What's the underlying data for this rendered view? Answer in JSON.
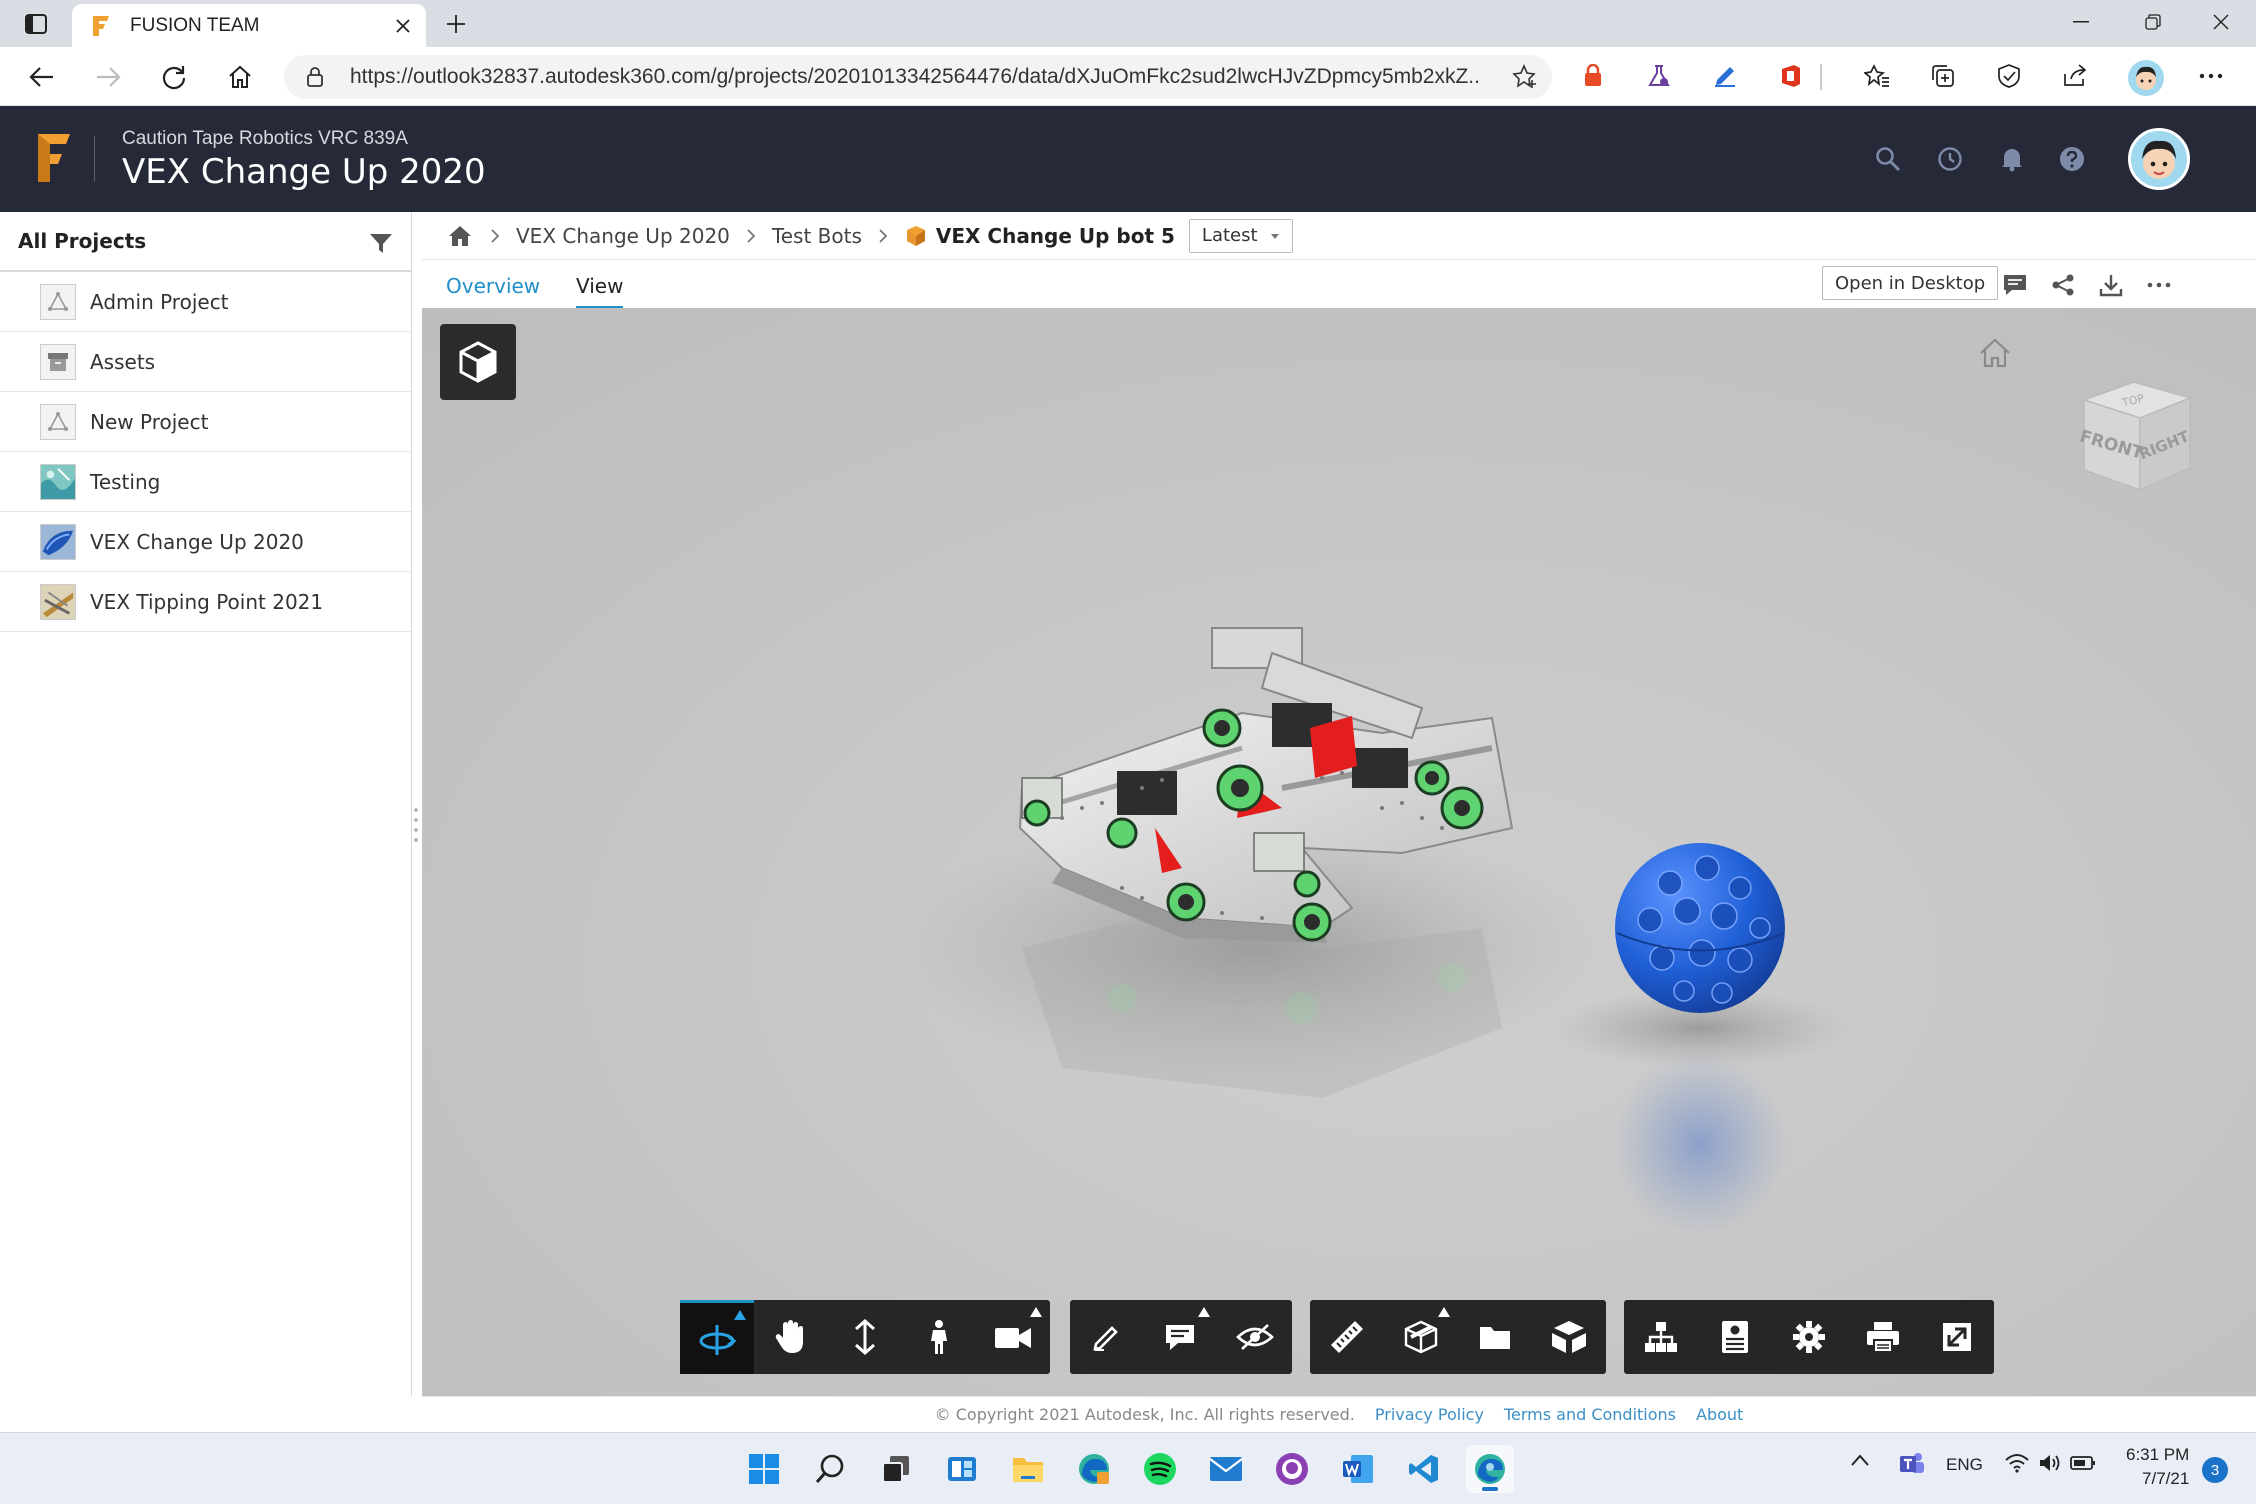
{
  "browser": {
    "tab_title": "FUSION TEAM",
    "url": "https://outlook32837.autodesk360.com/g/projects/20201013342564476/data/dXJuOmFkc2sud2lwcHJvZDpmcy5mb2xkZ..."
  },
  "header": {
    "hub_name": "Caution Tape Robotics VRC 839A",
    "project_title": "VEX Change Up 2020"
  },
  "sidebar": {
    "title": "All Projects",
    "items": [
      {
        "label": "Admin Project",
        "thumb": "project-icon"
      },
      {
        "label": "Assets",
        "thumb": "archive-icon"
      },
      {
        "label": "New Project",
        "thumb": "project-icon"
      },
      {
        "label": "Testing",
        "thumb": "image-thumb"
      },
      {
        "label": "VEX Change Up 2020",
        "thumb": "image-thumb"
      },
      {
        "label": "VEX Tipping Point 2021",
        "thumb": "image-thumb"
      }
    ]
  },
  "breadcrumb": {
    "items": [
      "VEX Change Up 2020",
      "Test Bots"
    ],
    "current": "VEX Change Up bot 5",
    "version": "Latest"
  },
  "tabs": {
    "overview": "Overview",
    "view": "View",
    "open_desktop": "Open in Desktop"
  },
  "viewcube": {
    "top": "TOP",
    "front": "FRONT",
    "right": "RIGHT"
  },
  "footer": {
    "copyright": "© Copyright 2021 Autodesk, Inc. All rights reserved.",
    "privacy": "Privacy Policy",
    "terms": "Terms and Conditions",
    "about": "About"
  },
  "taskbar": {
    "lang": "ENG",
    "time": "6:31 PM",
    "date": "7/7/21",
    "notifications": "3"
  },
  "colors": {
    "header_bg": "#262a38",
    "accent": "#1f8fc8",
    "viewer_bg": "#c3c3c3",
    "toolbar_bg": "#262626",
    "fusion_orange": "#f0a030"
  }
}
